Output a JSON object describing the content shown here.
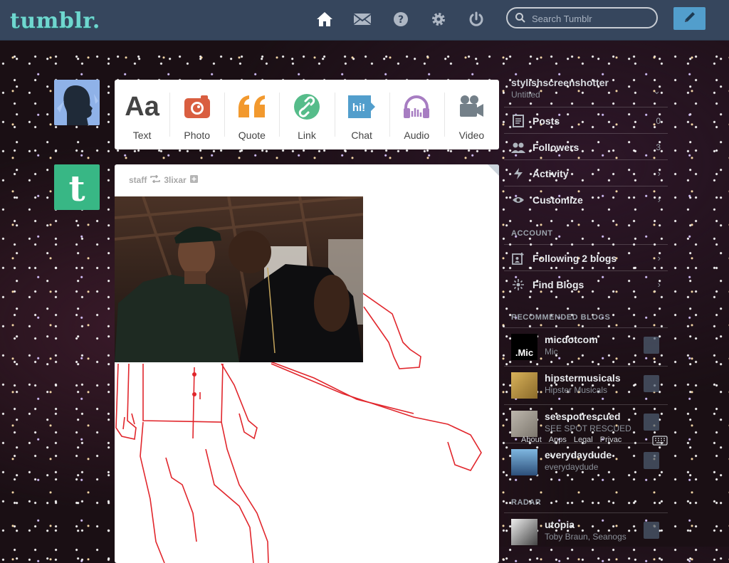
{
  "header": {
    "logo": "tumblr.",
    "search_placeholder": "Search Tumblr",
    "nav": [
      {
        "icon": "home-icon"
      },
      {
        "icon": "mail-icon"
      },
      {
        "icon": "help-icon"
      },
      {
        "icon": "gear-icon"
      },
      {
        "icon": "power-icon"
      }
    ],
    "compose_icon": "pencil-icon"
  },
  "post_types": [
    {
      "label": "Text",
      "icon": "text-icon",
      "color": "#444444"
    },
    {
      "label": "Photo",
      "icon": "camera-icon",
      "color": "#d95e40"
    },
    {
      "label": "Quote",
      "icon": "quote-icon",
      "color": "#f2992e"
    },
    {
      "label": "Link",
      "icon": "link-icon",
      "color": "#56bc8a"
    },
    {
      "label": "Chat",
      "icon": "chat-icon",
      "color": "#529ecc"
    },
    {
      "label": "Audio",
      "icon": "headphones-icon",
      "color": "#a77dc2"
    },
    {
      "label": "Video",
      "icon": "video-camera-icon",
      "color": "#748089"
    }
  ],
  "post": {
    "author": "staff",
    "reblogged_from": "3lixar"
  },
  "sidebar": {
    "blog_name": "stylishscreenshotter",
    "blog_sub": "Untitled",
    "rows": [
      {
        "label": "Posts",
        "count": "0",
        "icon": "posts-icon"
      },
      {
        "label": "Followers",
        "count": "3",
        "icon": "followers-icon"
      },
      {
        "label": "Activity",
        "count": "",
        "icon": "activity-icon"
      },
      {
        "label": "Customize",
        "count": "",
        "icon": "eye-icon"
      }
    ],
    "account_heading": "ACCOUNT",
    "account_rows": [
      {
        "label": "Following 2 blogs",
        "icon": "following-icon"
      },
      {
        "label": "Find Blogs",
        "icon": "find-blogs-icon"
      }
    ],
    "recommended_heading": "RECOMMENDED BLOGS",
    "recommended": [
      {
        "name": "micdotcom",
        "sub": "Mic",
        "avatar_text": ".Mic"
      },
      {
        "name": "hipstermusicals",
        "sub": "Hipster Musicals",
        "avatar_text": ""
      },
      {
        "name": "seespotrescued",
        "sub": "SEE SPOT RESCUED",
        "avatar_text": ""
      },
      {
        "name": "everydaydude",
        "sub": "everydaydude",
        "avatar_text": ""
      }
    ],
    "footer_links": [
      "About",
      "Apps",
      "Legal",
      "Privac"
    ],
    "radar_heading": "RADAR",
    "radar": {
      "name": "utopia",
      "sub": "Toby Braun, Seanogs"
    }
  }
}
